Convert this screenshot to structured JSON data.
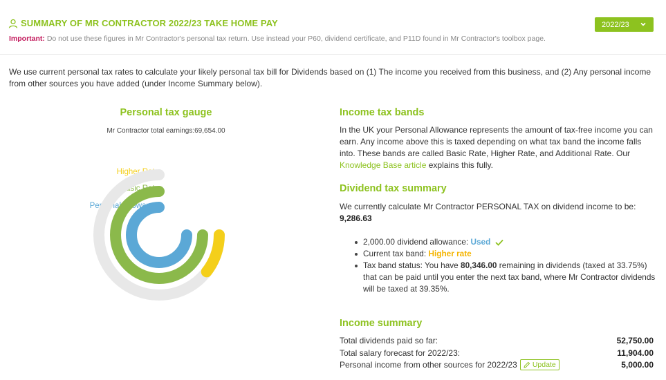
{
  "header": {
    "title": "SUMMARY OF MR CONTRACTOR 2022/23 TAKE HOME PAY",
    "important_label": "Important:",
    "important_text": " Do not use these figures in Mr Contractor's personal tax return. Use instead your P60, dividend certificate, and P11D found in Mr Contractor's toolbox page.",
    "year_selector": "2022/23"
  },
  "intro": "We use current personal tax rates to calculate your likely personal tax bill for Dividends based on (1) The income you received from this business, and (2) Any personal income from other sources you have added (under Income Summary below).",
  "gauge": {
    "title": "Personal tax gauge",
    "earnings_label": "Mr Contractor total earnings:",
    "earnings_value": "69,654.00",
    "legend": [
      {
        "label": "Higher Rate",
        "color": "#f4cf1a"
      },
      {
        "label": "Basic Rate",
        "color": "#8bb94b"
      },
      {
        "label": "Personal Allowance",
        "color": "#5ba8d6"
      }
    ],
    "track_color": "#e8e8e8",
    "levels": {
      "higher_rate": 0.14,
      "basic_rate": 1.0,
      "personal_allowance": 1.0
    }
  },
  "bands": {
    "title": "Income tax bands",
    "text": "In the UK your Personal Allowance represents the amount of tax-free income you can earn. Any income above this is taxed depending on what tax band the income falls into. These bands are called Basic Rate, Higher Rate, and Additional Rate. Our ",
    "link": "Knowledge Base article",
    "text_after": " explains this fully."
  },
  "dividend": {
    "title": "Dividend tax summary",
    "text": "We currently calculate Mr Contractor PERSONAL TAX on dividend income to be:",
    "amount": "9,286.63",
    "b1_text": "2,000.00 dividend allowance: ",
    "b1_status": "Used",
    "b2_text": "Current tax band: ",
    "b2_band": "Higher rate",
    "b3_pre": "Tax band status: You have ",
    "b3_amount": "80,346.00",
    "b3_post": " remaining in dividends (taxed at 33.75%) that can be paid until you enter the next tax band, where Mr Contractor dividends will be taxed at 39.35%."
  },
  "income": {
    "title": "Income summary",
    "rows": [
      {
        "label": "Total dividends paid so far:",
        "value": "52,750.00"
      },
      {
        "label": "Total salary forecast for 2022/23:",
        "value": "11,904.00"
      },
      {
        "label": "Personal income from other sources for 2022/23",
        "value": "5,000.00"
      }
    ],
    "update_label": "Update"
  },
  "colors": {
    "accent": "#8dc21f",
    "important": "#c2185b"
  }
}
